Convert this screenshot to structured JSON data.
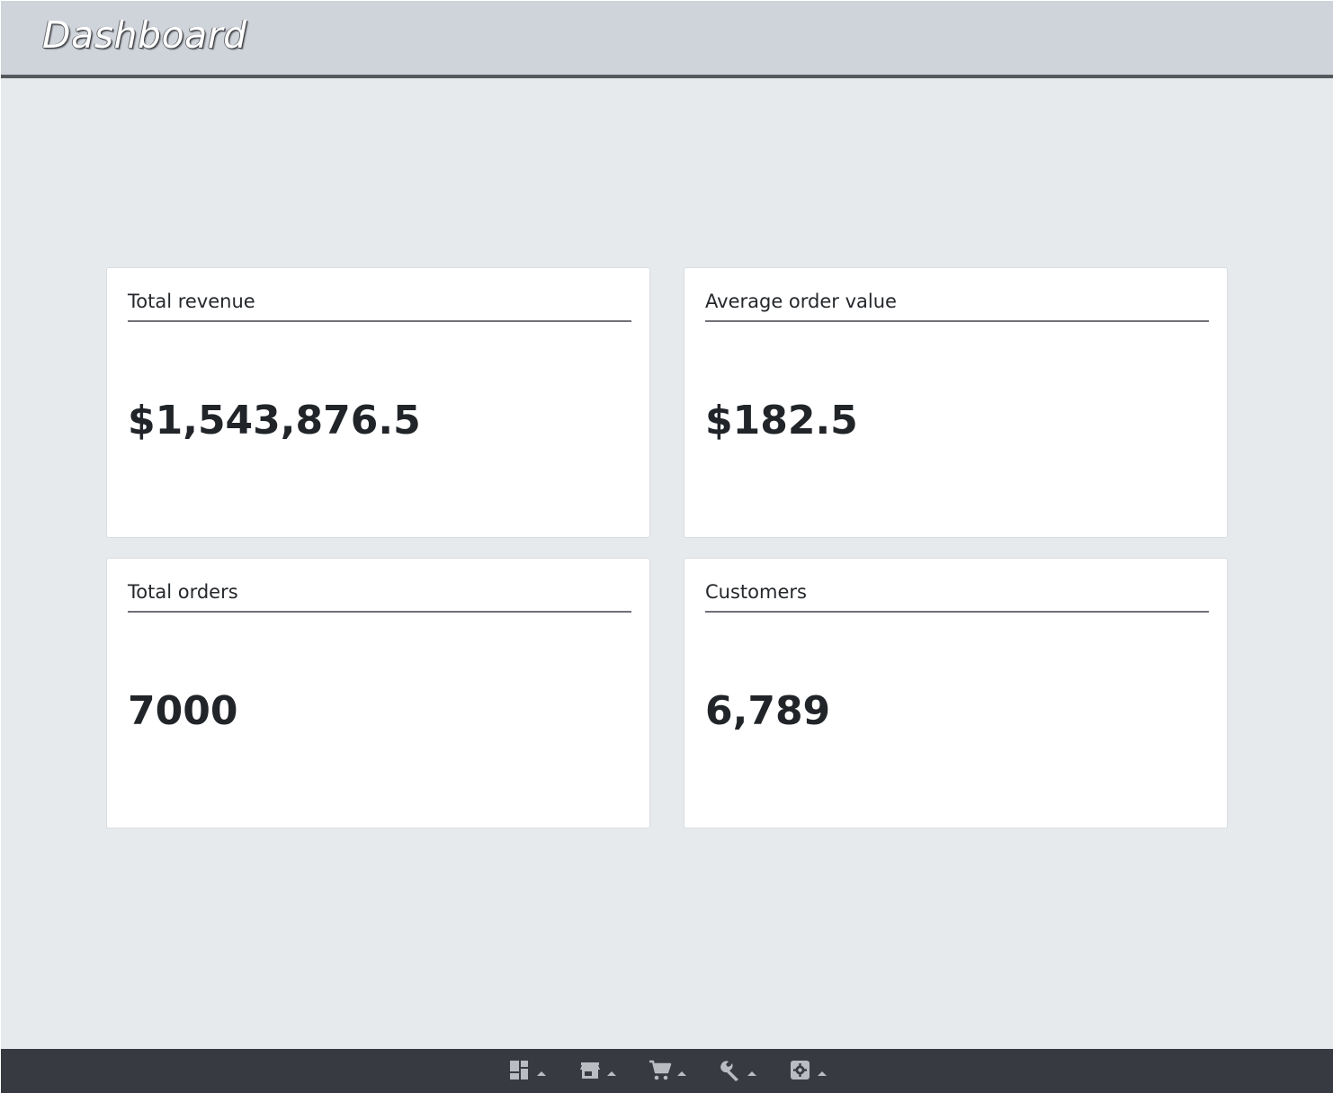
{
  "header": {
    "title": "Dashboard"
  },
  "cards": [
    {
      "title": "Total revenue",
      "value": "$1,543,876.5"
    },
    {
      "title": "Average order value",
      "value": "$182.5"
    },
    {
      "title": "Total orders",
      "value": "7000"
    },
    {
      "title": "Customers",
      "value": "6,789"
    }
  ],
  "taskbar": {
    "items": [
      {
        "icon": "dashboard-icon"
      },
      {
        "icon": "store-icon"
      },
      {
        "icon": "cart-icon"
      },
      {
        "icon": "wrench-icon"
      },
      {
        "icon": "settings-icon"
      }
    ]
  },
  "colors": {
    "header_bg": "#cfd3da",
    "page_bg": "#e7eaed",
    "taskbar_bg": "#373a40",
    "icon": "#b9bcc1"
  }
}
